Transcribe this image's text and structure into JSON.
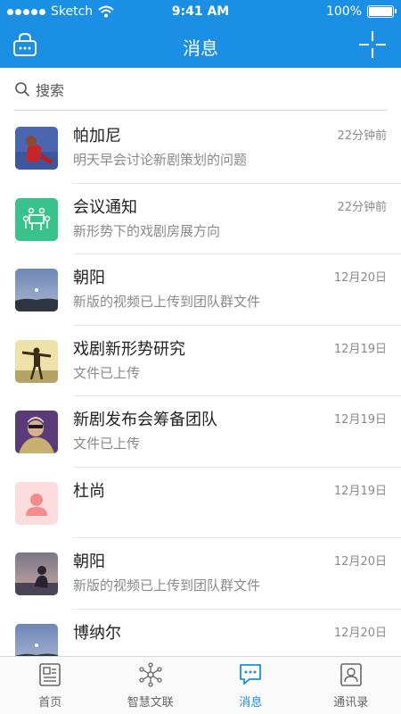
{
  "status_bar": {
    "carrier": "Sketch",
    "time": "9:41 AM",
    "battery": "100%"
  },
  "nav": {
    "title": "消息",
    "left_icon": "lock-bag-icon",
    "right_icon": "crosshair-icon"
  },
  "search": {
    "placeholder": "搜索"
  },
  "conversations": [
    {
      "name": "帕加尼",
      "message": "明天早会讨论新剧策划的问题",
      "time": "22分钟前",
      "avatar": "photo-girl-red"
    },
    {
      "name": "会议通知",
      "message": "新形势下的戏剧房展方向",
      "time": "22分钟前",
      "avatar": "meeting-icon"
    },
    {
      "name": "朝阳",
      "message": "新版的视频已上传到团队群文件",
      "time": "12月20日",
      "avatar": "photo-moon"
    },
    {
      "name": "戏剧新形势研究",
      "message": "文件已上传",
      "time": "12月19日",
      "avatar": "photo-jump"
    },
    {
      "name": "新剧发布会筹备团队",
      "message": "文件已上传",
      "time": "12月19日",
      "avatar": "photo-man"
    },
    {
      "name": "杜尚",
      "message": "",
      "time": "12月19日",
      "avatar": "person-placeholder"
    },
    {
      "name": "朝阳",
      "message": "新版的视频已上传到团队群文件",
      "time": "12月20日",
      "avatar": "photo-sunset"
    },
    {
      "name": "博纳尔",
      "message": "",
      "time": "12月20日",
      "avatar": "photo-moon"
    }
  ],
  "tabs": [
    {
      "label": "首页",
      "icon": "home-icon",
      "active": false
    },
    {
      "label": "智慧文联",
      "icon": "network-icon",
      "active": false
    },
    {
      "label": "消息",
      "icon": "chat-icon",
      "active": true
    },
    {
      "label": "通讯录",
      "icon": "contacts-icon",
      "active": false
    }
  ],
  "colors": {
    "primary": "#1b8fe4",
    "meeting_icon_bg": "#3ac28d",
    "placeholder_bg": "#fcdcdc"
  }
}
